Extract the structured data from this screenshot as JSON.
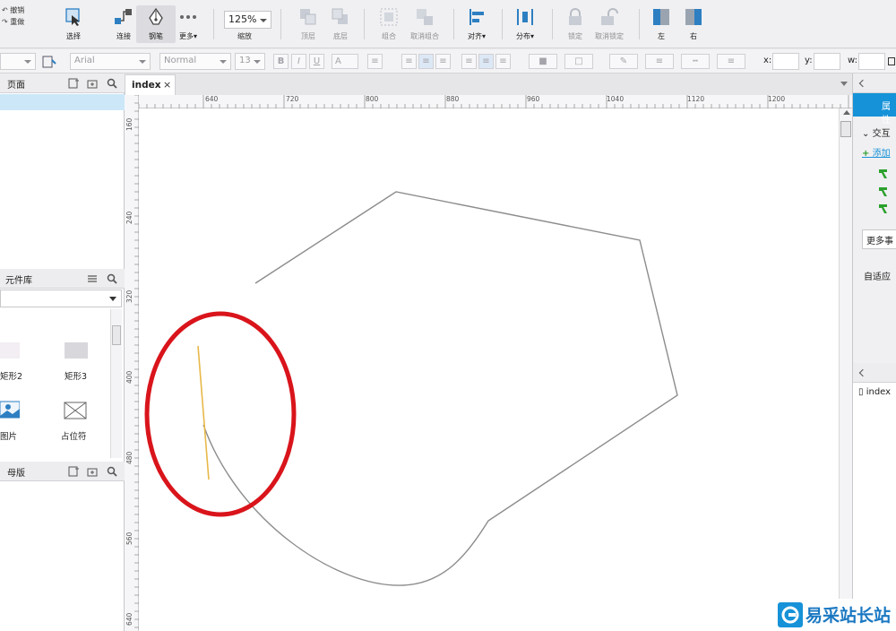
{
  "toolbar": {
    "undo_label": "撤销",
    "redo_label": "重做",
    "select_label": "选择",
    "connect_label": "连接",
    "pen_label": "钢笔",
    "more_label": "更多",
    "more_caret": "▾",
    "zoom_value": "125%",
    "zoom_label": "缩放",
    "top_label": "顶层",
    "bottom_label": "底层",
    "group_label": "组合",
    "ungroup_label": "取消组合",
    "align_label": "对齐",
    "distribute_label": "分布",
    "lock_label": "锁定",
    "unlock_label": "取消锁定",
    "left_label": "左",
    "right_label": "右"
  },
  "formatbar": {
    "font_family": "Arial",
    "font_style": "Normal",
    "font_size": "13",
    "bold": "B",
    "italic": "I",
    "underline": "U",
    "text_color_letter": "A",
    "x_label": "x:",
    "y_label": "y:",
    "w_label": "w:"
  },
  "left_panels": {
    "pages_title": "页面",
    "library_title": "元件库",
    "masters_title": "母版",
    "widgets": [
      {
        "label": "矩形2"
      },
      {
        "label": "矩形3"
      },
      {
        "label": "图片"
      },
      {
        "label": "占位符"
      }
    ]
  },
  "tabs": [
    {
      "label": "index",
      "close": "×"
    }
  ],
  "rulers": {
    "horizontal": [
      "640",
      "720",
      "800",
      "880",
      "960",
      "1040",
      "1120",
      "1200"
    ],
    "vertical": [
      "160",
      "240",
      "320",
      "400",
      "480",
      "560",
      "640"
    ]
  },
  "right_panel": {
    "header": "属性",
    "interactions_label": "交互",
    "add_case_label": "添加",
    "more_events_label": "更多事",
    "adaptive_label": "自适应",
    "outline_item": "index"
  },
  "watermark": {
    "text": "易采站长站"
  },
  "colors": {
    "accent": "#1692d8",
    "highlight_circle": "#d9141b",
    "pen_line": "#e8b84a",
    "shape_stroke": "#8c8c8c"
  }
}
